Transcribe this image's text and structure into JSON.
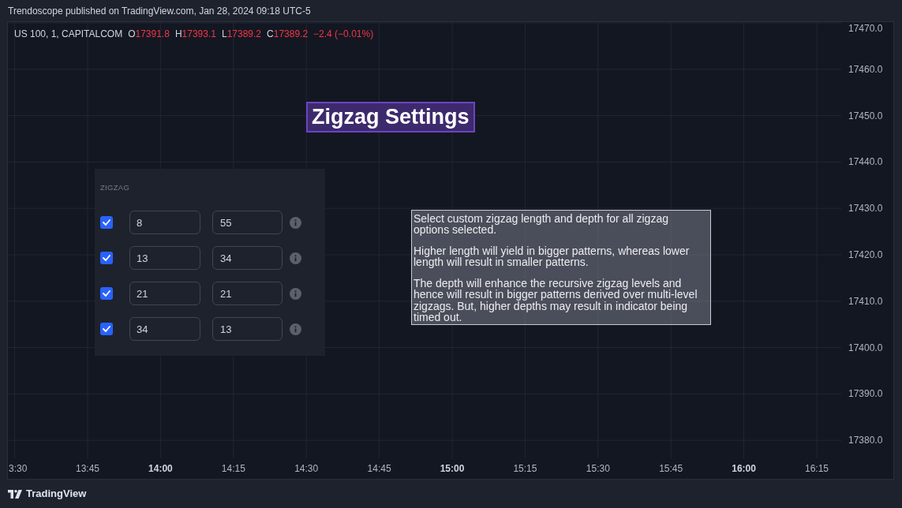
{
  "header": {
    "attribution": "Trendoscope published on TradingView.com, Jan 28, 2024 09:18 UTC-5"
  },
  "chart": {
    "legend": {
      "symbol": "US 100, 1, CAPITALCOM",
      "values": [
        {
          "label": "O",
          "value": "17391.8"
        },
        {
          "label": "H",
          "value": "17393.1"
        },
        {
          "label": "L",
          "value": "17389.2"
        },
        {
          "label": "C",
          "value": "17389.2"
        }
      ],
      "change": "−2.4 (−0.01%)"
    },
    "title_banner": {
      "text": "Zigzag Settings"
    },
    "settings_panel": {
      "section": "ZIGZAG",
      "rows": [
        {
          "checked": true,
          "inputs": [
            "8",
            "55"
          ]
        },
        {
          "checked": true,
          "inputs": [
            "13",
            "34"
          ]
        },
        {
          "checked": true,
          "inputs": [
            "21",
            "21"
          ]
        },
        {
          "checked": true,
          "inputs": [
            "34",
            "13"
          ]
        }
      ]
    },
    "tooltip": {
      "paragraphs": [
        "Select custom zigzag length and depth for all zigzag options selected.",
        "Higher length will yield in bigger patterns, whereas lower length will result in smaller patterns.",
        "The depth will enhance the recursive zigzag levels and hence will result in bigger patterns derived over multi-level zigzags. But, higher depths may result in indicator being timed out."
      ]
    },
    "price_axis": {
      "labels": [
        "17470.0",
        "17460.0",
        "17450.0",
        "17440.0",
        "17430.0",
        "17420.0",
        "17410.0",
        "17400.0",
        "17390.0",
        "17380.0"
      ]
    },
    "time_axis": {
      "labels": [
        {
          "text": "3:30",
          "major": false
        },
        {
          "text": "13:45",
          "major": false
        },
        {
          "text": "14:00",
          "major": true
        },
        {
          "text": "14:15",
          "major": false
        },
        {
          "text": "14:30",
          "major": false
        },
        {
          "text": "14:45",
          "major": false
        },
        {
          "text": "15:00",
          "major": true
        },
        {
          "text": "15:15",
          "major": false
        },
        {
          "text": "15:30",
          "major": false
        },
        {
          "text": "15:45",
          "major": false
        },
        {
          "text": "16:00",
          "major": true
        },
        {
          "text": "16:15",
          "major": false
        }
      ]
    }
  },
  "footer": {
    "brand": "TradingView"
  }
}
